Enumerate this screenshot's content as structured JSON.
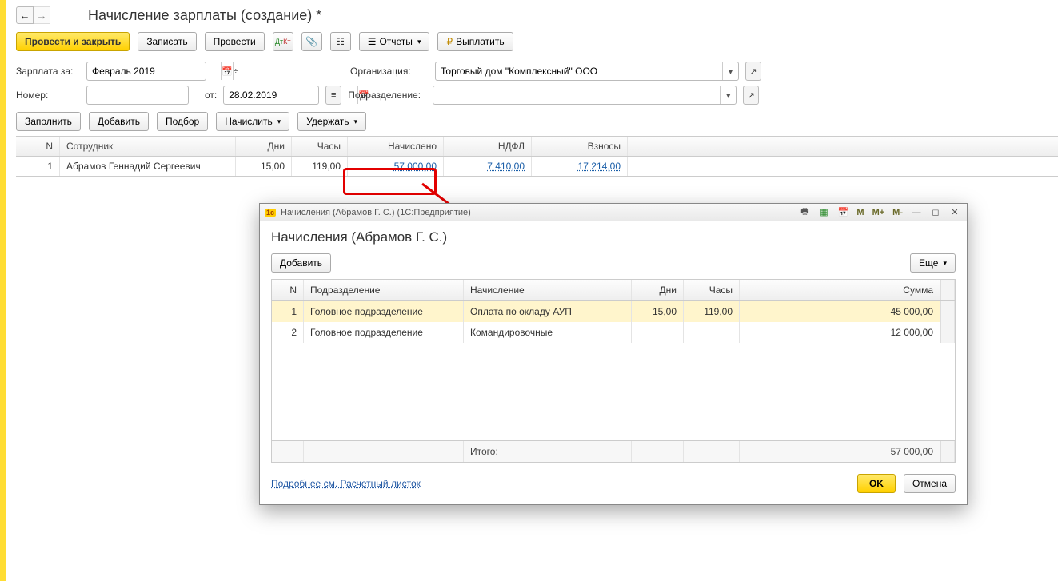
{
  "header": {
    "title": "Начисление зарплаты (создание) *"
  },
  "toolbar": {
    "post_close": "Провести и закрыть",
    "write": "Записать",
    "post": "Провести",
    "reports": "Отчеты",
    "pay": "Выплатить"
  },
  "form": {
    "salary_for_label": "Зарплата за:",
    "salary_for_value": "Февраль 2019",
    "org_label": "Организация:",
    "org_value": "Торговый дом \"Комплексный\" ООО",
    "number_label": "Номер:",
    "number_value": "",
    "from_label": "от:",
    "date_value": "28.02.2019",
    "dept_label": "Подразделение:",
    "dept_value": ""
  },
  "actions2": {
    "fill": "Заполнить",
    "add": "Добавить",
    "pick": "Подбор",
    "accrue": "Начислить",
    "withhold": "Удержать"
  },
  "main_table": {
    "headers": {
      "n": "N",
      "employee": "Сотрудник",
      "days": "Дни",
      "hours": "Часы",
      "accrued": "Начислено",
      "ndfl": "НДФЛ",
      "contrib": "Взносы"
    },
    "rows": [
      {
        "n": "1",
        "employee": "Абрамов Геннадий Сергеевич",
        "days": "15,00",
        "hours": "119,00",
        "accrued": "57 000,00",
        "ndfl": "7 410,00",
        "contrib": "17 214,00"
      }
    ]
  },
  "dialog": {
    "titlebar": "Начисления (Абрамов Г. С.)  (1С:Предприятие)",
    "heading": "Начисления (Абрамов Г. С.)",
    "add": "Добавить",
    "more": "Еще",
    "headers": {
      "n": "N",
      "dept": "Подразделение",
      "accr": "Начисление",
      "days": "Дни",
      "hours": "Часы",
      "sum": "Сумма"
    },
    "rows": [
      {
        "n": "1",
        "dept": "Головное подразделение",
        "accr": "Оплата по окладу АУП",
        "days": "15,00",
        "hours": "119,00",
        "sum": "45 000,00"
      },
      {
        "n": "2",
        "dept": "Головное подразделение",
        "accr": "Командировочные",
        "days": "",
        "hours": "",
        "sum": "12 000,00"
      }
    ],
    "total_label": "Итого:",
    "total_sum": "57 000,00",
    "moreinfo": "Подробнее см. Расчетный листок",
    "ok": "OK",
    "cancel": "Отмена",
    "toolbar_m": {
      "m": "M",
      "mplus": "M+",
      "mminus": "M-"
    }
  }
}
